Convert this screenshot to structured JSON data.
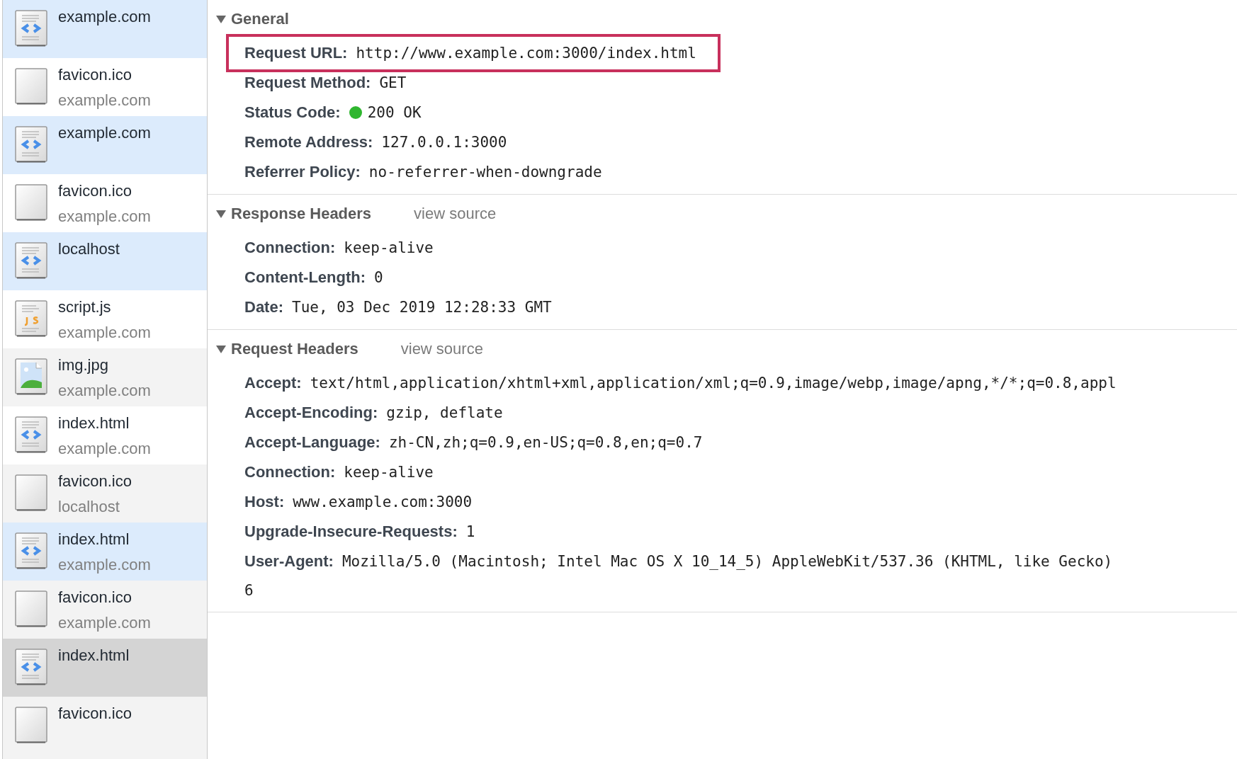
{
  "requests": [
    {
      "name": "example.com",
      "kind": "document",
      "highlighted": true,
      "selected": false
    },
    {
      "name": "favicon.ico",
      "domain": "example.com",
      "kind": "blank",
      "highlighted": false,
      "selected": false
    },
    {
      "name": "example.com",
      "kind": "document",
      "highlighted": true,
      "selected": false
    },
    {
      "name": "favicon.ico",
      "domain": "example.com",
      "kind": "blank",
      "highlighted": false,
      "selected": false
    },
    {
      "name": "localhost",
      "kind": "document",
      "highlighted": true,
      "selected": false
    },
    {
      "name": "script.js",
      "domain": "example.com",
      "kind": "script",
      "highlighted": false,
      "selected": false
    },
    {
      "name": "img.jpg",
      "domain": "example.com",
      "kind": "image",
      "highlighted": false,
      "selected": false
    },
    {
      "name": "index.html",
      "domain": "example.com",
      "kind": "document",
      "highlighted": false,
      "selected": false
    },
    {
      "name": "favicon.ico",
      "domain": "localhost",
      "kind": "blank",
      "highlighted": false,
      "selected": false
    },
    {
      "name": "index.html",
      "domain": "example.com",
      "kind": "document",
      "highlighted": true,
      "selected": false
    },
    {
      "name": "favicon.ico",
      "domain": "example.com",
      "kind": "blank",
      "highlighted": false,
      "selected": false
    },
    {
      "name": "index.html",
      "kind": "document",
      "highlighted": false,
      "selected": true
    },
    {
      "name": "favicon.ico",
      "kind": "blank",
      "highlighted": false,
      "selected": false
    }
  ],
  "sections": [
    {
      "title": "General",
      "expanded": true,
      "rows": [
        {
          "label": "Request URL:",
          "value": "http://www.example.com:3000/index.html",
          "highlighted": true
        },
        {
          "label": "Request Method:",
          "value": "GET"
        },
        {
          "label": "Status Code:",
          "value": "200 OK",
          "color": "#2fb62f"
        },
        {
          "label": "Remote Address:",
          "value": "127.0.0.1:3000"
        },
        {
          "label": "Referrer Policy:",
          "value": "no-referrer-when-downgrade"
        }
      ]
    },
    {
      "title": "Response Headers",
      "link": "view source",
      "expanded": true,
      "rows": [
        {
          "label": "Connection:",
          "value": "keep-alive"
        },
        {
          "label": "Content-Length:",
          "value": "0"
        },
        {
          "label": "Date:",
          "value": "Tue, 03 Dec 2019 12:28:33 GMT"
        }
      ]
    },
    {
      "title": "Request Headers",
      "link": "view source",
      "expanded": true,
      "rows": [
        {
          "label": "Accept:",
          "value": "text/html,application/xhtml+xml,application/xml;q=0.9,image/webp,image/apng,*/*;q=0.8,appl"
        },
        {
          "label": "Accept-Encoding:",
          "value": "gzip, deflate"
        },
        {
          "label": "Accept-Language:",
          "value": "zh-CN,zh;q=0.9,en-US;q=0.8,en;q=0.7"
        },
        {
          "label": "Connection:",
          "value": "keep-alive"
        },
        {
          "label": "Host:",
          "value": "www.example.com:3000"
        },
        {
          "label": "Upgrade-Insecure-Requests:",
          "value": "1"
        },
        {
          "label": "User-Agent:",
          "value": "Mozilla/5.0 (Macintosh; Intel Mac OS X 10_14_5) AppleWebKit/537.36 (KHTML, like Gecko)",
          "continuation": "6"
        }
      ]
    }
  ]
}
